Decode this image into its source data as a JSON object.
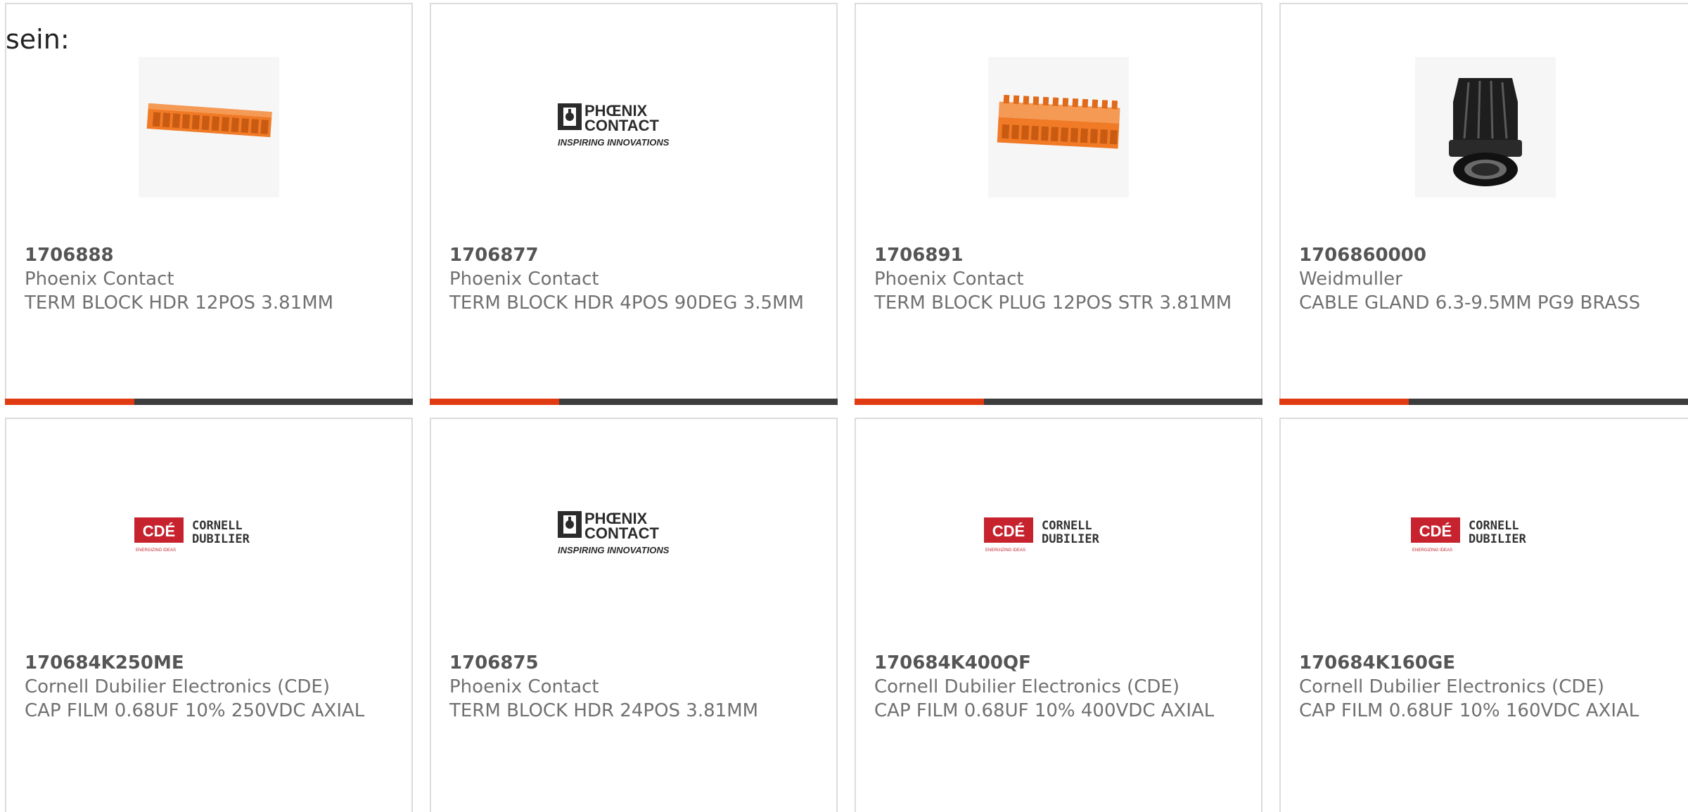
{
  "intro": "sein:",
  "colors": {
    "accent_bar": "#e03a12",
    "dark_bar": "#3d3d3d",
    "phoenix_orange": "#f07a26",
    "cde_red": "#c6232f"
  },
  "products": [
    {
      "part_number": "1706888",
      "manufacturer": "Phoenix Contact",
      "description": "TERM BLOCK HDR 12POS 3.81MM",
      "image": "orange-header-terminal-block"
    },
    {
      "part_number": "1706877",
      "manufacturer": "Phoenix Contact",
      "description": "TERM BLOCK HDR 4POS 90DEG 3.5MM",
      "image": "phoenix-contact-logo",
      "logo": {
        "line1": "PHŒNIX",
        "line2": "CONTACT",
        "tagline": "INSPIRING INNOVATIONS"
      }
    },
    {
      "part_number": "1706891",
      "manufacturer": "Phoenix Contact",
      "description": "TERM BLOCK PLUG 12POS STR 3.81MM",
      "image": "orange-plug-terminal-block"
    },
    {
      "part_number": "1706860000",
      "manufacturer": "Weidmuller",
      "description": "CABLE GLAND 6.3-9.5MM PG9 BRASS",
      "image": "black-cable-gland"
    },
    {
      "part_number": "170684K250ME",
      "manufacturer": "Cornell Dubilier Electronics (CDE)",
      "description": "CAP FILM 0.68UF 10% 250VDC AXIAL",
      "image": "cde-logo",
      "logo": {
        "mark": "CDÉ",
        "line1": "CORNELL",
        "line2": "DUBILIER",
        "tagline": "ENERGIZING IDEAS"
      }
    },
    {
      "part_number": "1706875",
      "manufacturer": "Phoenix Contact",
      "description": "TERM BLOCK HDR 24POS 3.81MM",
      "image": "phoenix-contact-logo",
      "logo": {
        "line1": "PHŒNIX",
        "line2": "CONTACT",
        "tagline": "INSPIRING INNOVATIONS"
      }
    },
    {
      "part_number": "170684K400QF",
      "manufacturer": "Cornell Dubilier Electronics (CDE)",
      "description": "CAP FILM 0.68UF 10% 400VDC AXIAL",
      "image": "cde-logo",
      "logo": {
        "mark": "CDÉ",
        "line1": "CORNELL",
        "line2": "DUBILIER",
        "tagline": "ENERGIZING IDEAS"
      }
    },
    {
      "part_number": "170684K160GE",
      "manufacturer": "Cornell Dubilier Electronics (CDE)",
      "description": "CAP FILM 0.68UF 10% 160VDC AXIAL",
      "image": "cde-logo",
      "logo": {
        "mark": "CDÉ",
        "line1": "CORNELL",
        "line2": "DUBILIER",
        "tagline": "ENERGIZING IDEAS"
      }
    }
  ]
}
